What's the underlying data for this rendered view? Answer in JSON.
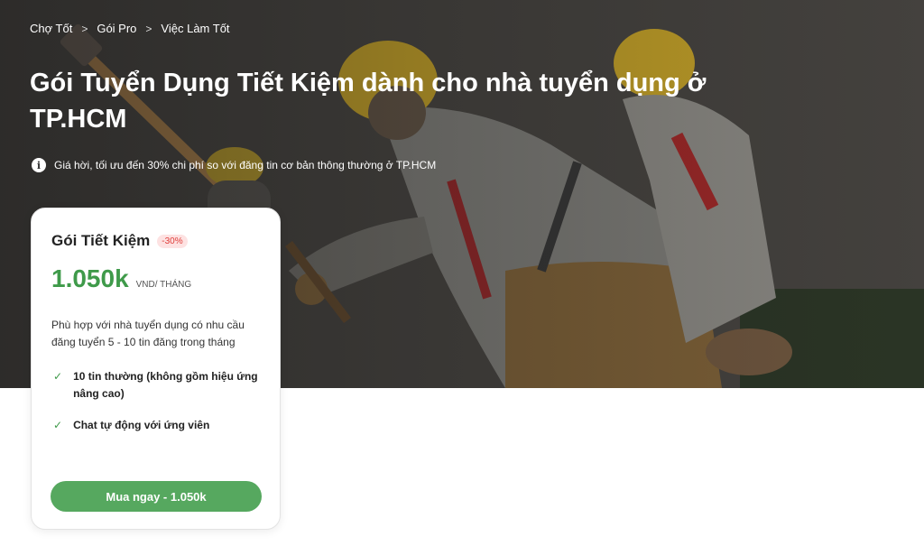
{
  "breadcrumb": {
    "items": [
      "Chợ Tốt",
      "Gói Pro",
      "Việc Làm Tốt"
    ],
    "separator": ">"
  },
  "hero": {
    "title": "Gói Tuyển Dụng Tiết Kiệm dành cho nhà tuyển dụng ở TP.HCM",
    "info_icon": "info-icon",
    "info_text": "Giá hời, tối ưu đến 30% chi phí so với đăng tin cơ bản thông thường ở TP.HCM"
  },
  "card": {
    "title": "Gói Tiết Kiệm",
    "discount_badge": "-30%",
    "price": "1.050k",
    "price_unit": "VND/ THÁNG",
    "description": "Phù hợp với nhà tuyển dụng có nhu cầu đăng tuyển 5 - 10 tin đăng trong tháng",
    "features": [
      "10 tin thường (không gồm hiệu ứng nâng cao)",
      "Chat tự động với ứng viên"
    ],
    "check_symbol": "✓",
    "buy_button": "Mua ngay - 1.050k"
  },
  "colors": {
    "accent_green": "#3f9a4a",
    "button_green": "#56a85f",
    "badge_bg": "#fde2e2",
    "badge_text": "#e0403c"
  }
}
